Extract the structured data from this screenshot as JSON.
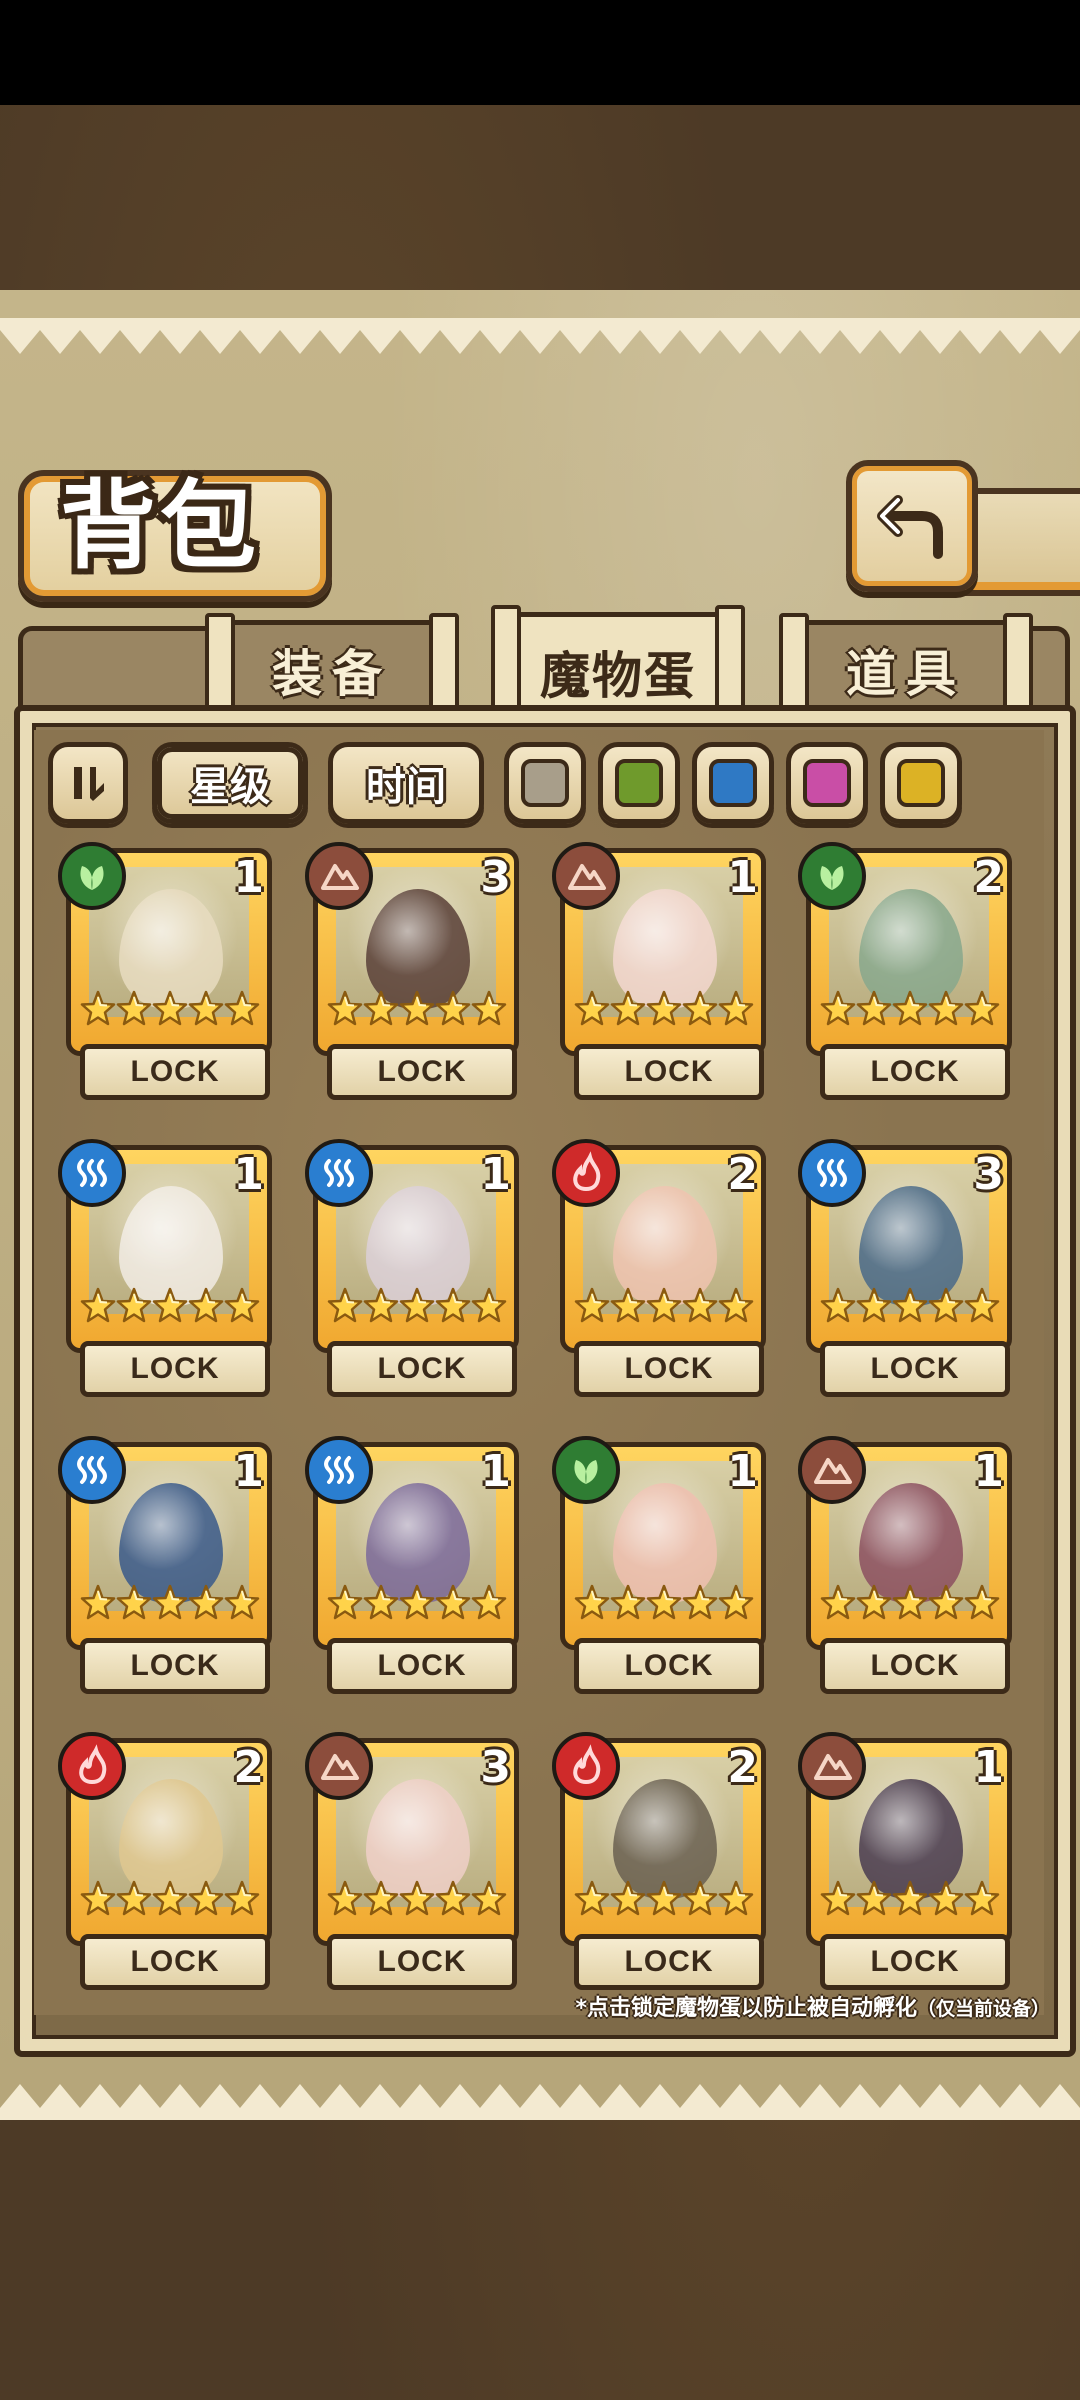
{
  "header": {
    "title": "背包"
  },
  "tabs": [
    {
      "label": "装备",
      "active": false
    },
    {
      "label": "魔物蛋",
      "active": true
    },
    {
      "label": "道具",
      "active": false
    }
  ],
  "sort": {
    "star_label": "星级",
    "time_label": "时间",
    "selected": "星级"
  },
  "filters": [
    {
      "name": "gray",
      "color": "#a89e8a"
    },
    {
      "name": "green",
      "color": "#6f9a2c"
    },
    {
      "name": "blue",
      "color": "#2f79c4"
    },
    {
      "name": "pink",
      "color": "#c94ea6"
    },
    {
      "name": "yellow",
      "color": "#dcb225"
    }
  ],
  "element_colors": {
    "grass": "#2f7d33",
    "rock": "#8c4d3c",
    "water": "#2a7ed0",
    "fire": "#cf2a2a"
  },
  "eggs": [
    {
      "element": "grass",
      "count": "1",
      "stars": 5,
      "lock": "LOCK"
    },
    {
      "element": "rock",
      "count": "3",
      "stars": 5,
      "lock": "LOCK"
    },
    {
      "element": "rock",
      "count": "1",
      "stars": 5,
      "lock": "LOCK"
    },
    {
      "element": "grass",
      "count": "2",
      "stars": 5,
      "lock": "LOCK"
    },
    {
      "element": "water",
      "count": "1",
      "stars": 5,
      "lock": "LOCK"
    },
    {
      "element": "water",
      "count": "1",
      "stars": 5,
      "lock": "LOCK"
    },
    {
      "element": "fire",
      "count": "2",
      "stars": 5,
      "lock": "LOCK"
    },
    {
      "element": "water",
      "count": "3",
      "stars": 5,
      "lock": "LOCK"
    },
    {
      "element": "water",
      "count": "1",
      "stars": 5,
      "lock": "LOCK"
    },
    {
      "element": "water",
      "count": "1",
      "stars": 5,
      "lock": "LOCK"
    },
    {
      "element": "grass",
      "count": "1",
      "stars": 5,
      "lock": "LOCK"
    },
    {
      "element": "rock",
      "count": "1",
      "stars": 5,
      "lock": "LOCK"
    },
    {
      "element": "fire",
      "count": "2",
      "stars": 5,
      "lock": "LOCK"
    },
    {
      "element": "rock",
      "count": "3",
      "stars": 5,
      "lock": "LOCK"
    },
    {
      "element": "fire",
      "count": "2",
      "stars": 5,
      "lock": "LOCK"
    },
    {
      "element": "rock",
      "count": "1",
      "stars": 5,
      "lock": "LOCK"
    }
  ],
  "footnote": {
    "main": "*点击锁定魔物蛋以防止被自动孵化",
    "note": "（仅当前设备）"
  }
}
